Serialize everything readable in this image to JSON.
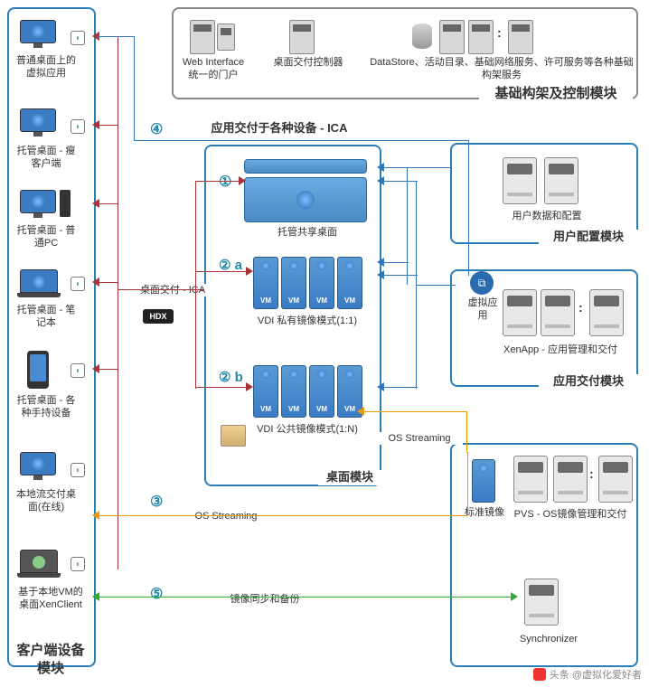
{
  "left": {
    "title": "客户端设备模块",
    "items": [
      {
        "label": "普通桌面上的虚拟应用",
        "kind": "desktop"
      },
      {
        "label": "托管桌面 - 瘦客户端",
        "kind": "desktop"
      },
      {
        "label": "托管桌面 - 普通PC",
        "kind": "pc"
      },
      {
        "label": "托管桌面 - 笔记本",
        "kind": "laptop"
      },
      {
        "label": "托管桌面 - 各种手持设备",
        "kind": "phone"
      },
      {
        "label": "本地流交付桌面(在线)",
        "kind": "desktop"
      },
      {
        "label": "基于本地VM的桌面XenClient",
        "kind": "laptop"
      }
    ]
  },
  "top": {
    "title": "基础构架及控制模块",
    "items": [
      {
        "label1": "Web Interface",
        "label2": "统一的门户"
      },
      {
        "label1": "桌面交付控制器",
        "label2": ""
      },
      {
        "label1": "DataStore、活动目录、基础网络服务、许可服务等各种基础构架服务",
        "label2": ""
      }
    ]
  },
  "center": {
    "title": "桌面模块",
    "ica_title": "应用交付于各种设备 - ICA",
    "desktop_ica": "桌面交付 - ICA",
    "hdx": "HDX",
    "hosted": "托管共享桌面",
    "vdi_private": "VDI 私有镜像模式(1:1)",
    "vdi_public": "VDI 公共镜像模式(1:N)",
    "vm": "VM",
    "os_stream": "OS Streaming",
    "mirror_sync": "镜像同步和备份",
    "std_image": "标准镜像"
  },
  "right": {
    "user_cfg": {
      "title": "用户配置模块",
      "label": "用户数据和配置"
    },
    "app_deliver": {
      "title": "应用交付模块",
      "label": "XenApp - 应用管理和交付",
      "virt": "虚拟应用"
    },
    "os": {
      "label": "PVS - OS镜像管理和交付"
    },
    "sync": {
      "label": "Synchronizer"
    }
  },
  "nums": {
    "n1": "①",
    "n2a": "② a",
    "n2b": "② b",
    "n3": "③",
    "n4": "④",
    "n5": "⑤"
  },
  "watermark": "头条 @虚拟化爱好者"
}
